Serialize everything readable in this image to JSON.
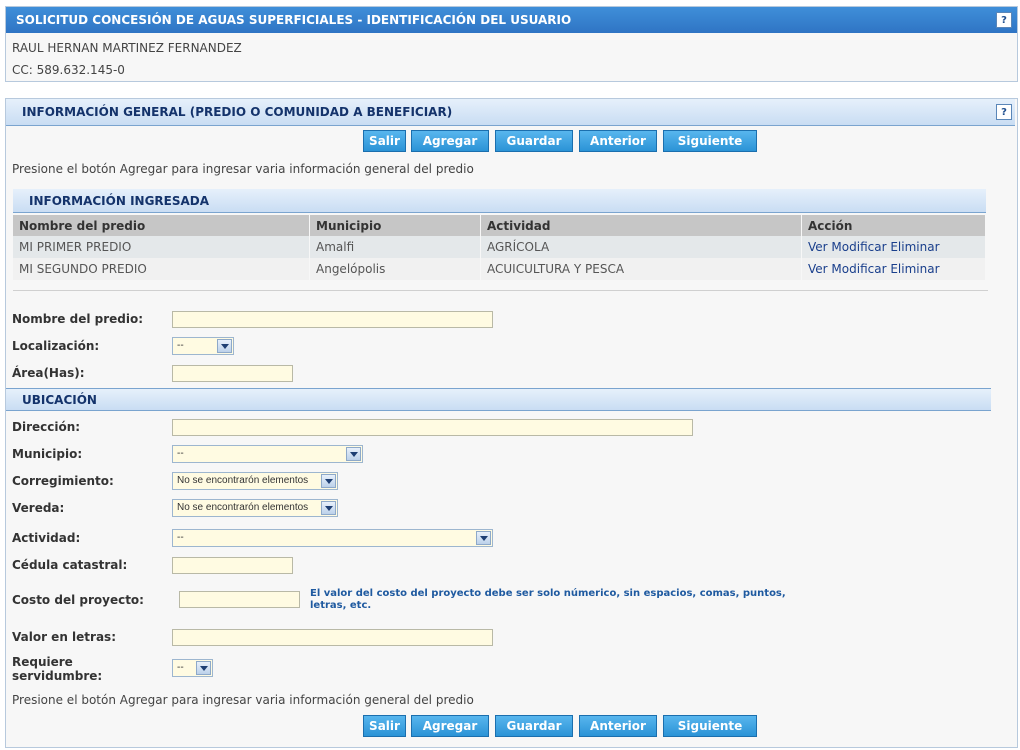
{
  "user_panel": {
    "title": "SOLICITUD CONCESIÓN DE AGUAS SUPERFICIALES - IDENTIFICACIÓN DEL USUARIO",
    "help": "?",
    "name": "RAUL HERNAN MARTINEZ FERNANDEZ",
    "id_line": "CC: 589.632.145-0"
  },
  "general_panel": {
    "title": "INFORMACIÓN GENERAL (PREDIO O COMUNIDAD A BENEFICIAR)",
    "help": "?",
    "buttons": {
      "exit": "Salir",
      "add": "Agregar",
      "save": "Guardar",
      "prev": "Anterior",
      "next": "Siguiente"
    },
    "instruction": "Presione el botón Agregar para ingresar varia información general del predio",
    "entered_section_title": "INFORMACIÓN INGRESADA",
    "table": {
      "headers": [
        "Nombre del predio",
        "Municipio",
        "Actividad",
        "Acción"
      ],
      "rows": [
        {
          "name": "MI PRIMER PREDIO",
          "municipality": "Amalfi",
          "activity": "AGRÍCOLA",
          "view": "Ver",
          "modify": "Modificar",
          "delete": "Eliminar"
        },
        {
          "name": "MI SEGUNDO PREDIO",
          "municipality": "Angelópolis",
          "activity": "ACUICULTURA Y PESCA",
          "view": "Ver",
          "modify": "Modificar",
          "delete": "Eliminar"
        }
      ]
    },
    "form": {
      "property_name_label": "Nombre del predio:",
      "property_name_value": "",
      "location_label": "Localización:",
      "location_value": "--",
      "area_label": "Área(Has):",
      "area_value": ""
    },
    "location_section": {
      "title": "UBICACIÓN",
      "address_label": "Dirección:",
      "address_value": "",
      "municipality_label": "Municipio:",
      "municipality_value": "--",
      "corregimiento_label": "Corregimiento:",
      "corregimiento_value": "No se encontrarón elementos",
      "vereda_label": "Vereda:",
      "vereda_value": "No se encontrarón elementos",
      "activity_label": "Actividad:",
      "activity_value": "--",
      "cadastral_label": "Cédula catastral:",
      "cadastral_value": "",
      "cost_label": "Costo del proyecto:",
      "cost_value": "",
      "cost_hint": "El valor del costo del proyecto debe ser solo númerico, sin espacios, comas, puntos, letras, etc.",
      "words_label": "Valor en letras:",
      "words_value": "",
      "easement_label_1": "Requiere",
      "easement_label_2": "servidumbre:",
      "easement_value": "--"
    }
  }
}
